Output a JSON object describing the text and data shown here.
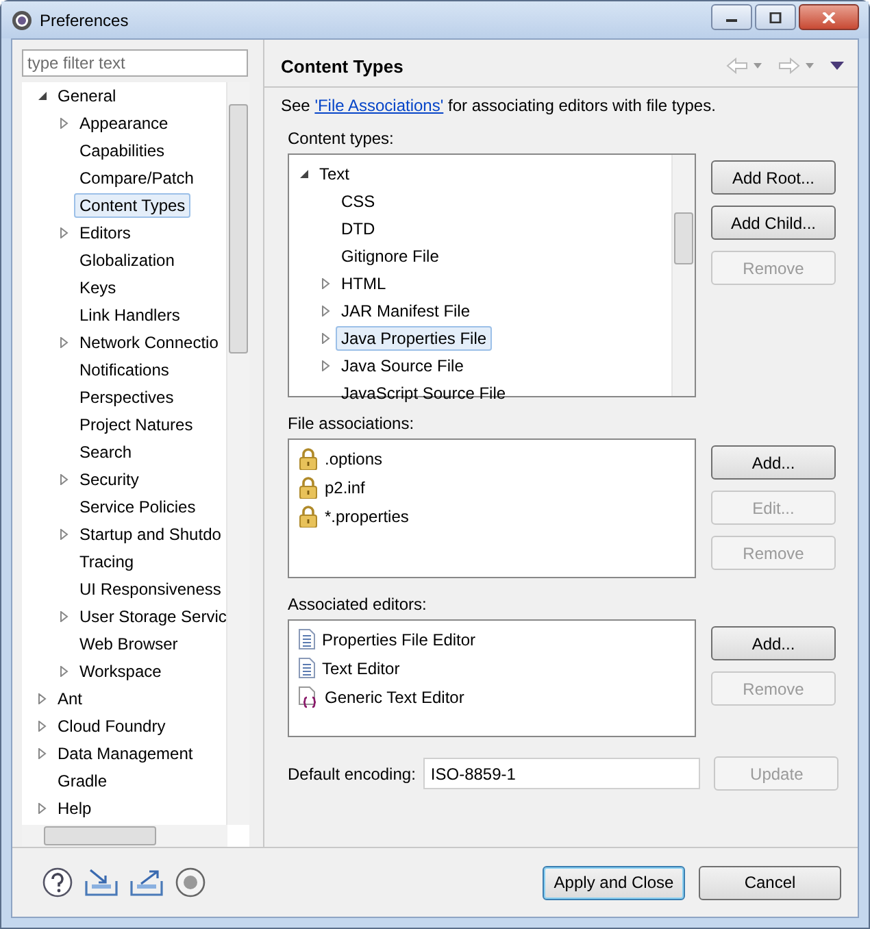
{
  "window": {
    "title": "Preferences"
  },
  "filter": {
    "placeholder": "type filter text"
  },
  "nav_tree": [
    {
      "label": "General",
      "expandable": true,
      "expanded": true,
      "selected": false,
      "children": [
        {
          "label": "Appearance",
          "expandable": true,
          "expanded": false,
          "selected": false
        },
        {
          "label": "Capabilities",
          "expandable": false,
          "selected": false
        },
        {
          "label": "Compare/Patch",
          "expandable": false,
          "selected": false
        },
        {
          "label": "Content Types",
          "expandable": false,
          "selected": true
        },
        {
          "label": "Editors",
          "expandable": true,
          "expanded": false,
          "selected": false
        },
        {
          "label": "Globalization",
          "expandable": false,
          "selected": false
        },
        {
          "label": "Keys",
          "expandable": false,
          "selected": false
        },
        {
          "label": "Link Handlers",
          "expandable": false,
          "selected": false
        },
        {
          "label": "Network Connectio",
          "expandable": true,
          "expanded": false,
          "selected": false
        },
        {
          "label": "Notifications",
          "expandable": false,
          "selected": false
        },
        {
          "label": "Perspectives",
          "expandable": false,
          "selected": false
        },
        {
          "label": "Project Natures",
          "expandable": false,
          "selected": false
        },
        {
          "label": "Search",
          "expandable": false,
          "selected": false
        },
        {
          "label": "Security",
          "expandable": true,
          "expanded": false,
          "selected": false
        },
        {
          "label": "Service Policies",
          "expandable": false,
          "selected": false
        },
        {
          "label": "Startup and Shutdo",
          "expandable": true,
          "expanded": false,
          "selected": false
        },
        {
          "label": "Tracing",
          "expandable": false,
          "selected": false
        },
        {
          "label": "UI Responsiveness",
          "expandable": false,
          "selected": false
        },
        {
          "label": "User Storage Servic",
          "expandable": true,
          "expanded": false,
          "selected": false
        },
        {
          "label": "Web Browser",
          "expandable": false,
          "selected": false
        },
        {
          "label": "Workspace",
          "expandable": true,
          "expanded": false,
          "selected": false
        }
      ]
    },
    {
      "label": "Ant",
      "expandable": true,
      "expanded": false,
      "selected": false
    },
    {
      "label": "Cloud Foundry",
      "expandable": true,
      "expanded": false,
      "selected": false
    },
    {
      "label": "Data Management",
      "expandable": true,
      "expanded": false,
      "selected": false
    },
    {
      "label": "Gradle",
      "expandable": false,
      "selected": false
    },
    {
      "label": "Help",
      "expandable": true,
      "expanded": false,
      "selected": false
    }
  ],
  "page": {
    "title": "Content Types",
    "intro_before": "See ",
    "intro_link": "'File Associations'",
    "intro_after": " for associating editors with file types."
  },
  "content_types": {
    "label": "Content types:",
    "tree": [
      {
        "label": "Text",
        "expandable": true,
        "expanded": true,
        "selected": false,
        "children": [
          {
            "label": "CSS",
            "expandable": false,
            "selected": false
          },
          {
            "label": "DTD",
            "expandable": false,
            "selected": false
          },
          {
            "label": "Gitignore File",
            "expandable": false,
            "selected": false
          },
          {
            "label": "HTML",
            "expandable": true,
            "expanded": false,
            "selected": false
          },
          {
            "label": "JAR Manifest File",
            "expandable": true,
            "expanded": false,
            "selected": false
          },
          {
            "label": "Java Properties File",
            "expandable": true,
            "expanded": false,
            "selected": true
          },
          {
            "label": "Java Source File",
            "expandable": true,
            "expanded": false,
            "selected": false
          },
          {
            "label": "JavaScript Source File",
            "expandable": false,
            "selected": false
          }
        ]
      }
    ],
    "buttons": [
      {
        "label": "Add Root...",
        "disabled": false
      },
      {
        "label": "Add Child...",
        "disabled": false
      },
      {
        "label": "Remove",
        "disabled": true
      }
    ]
  },
  "file_associations": {
    "label": "File associations:",
    "items": [
      ".options",
      "p2.inf",
      "*.properties"
    ],
    "buttons": [
      {
        "label": "Add...",
        "disabled": false
      },
      {
        "label": "Edit...",
        "disabled": true
      },
      {
        "label": "Remove",
        "disabled": true
      }
    ]
  },
  "associated_editors": {
    "label": "Associated editors:",
    "items": [
      {
        "label": "Properties File Editor",
        "kind": "document"
      },
      {
        "label": "Text Editor",
        "kind": "document"
      },
      {
        "label": "Generic Text Editor",
        "kind": "generic"
      }
    ],
    "buttons": [
      {
        "label": "Add...",
        "disabled": false
      },
      {
        "label": "Remove",
        "disabled": true
      }
    ]
  },
  "encoding": {
    "label": "Default encoding:",
    "value": "ISO-8859-1",
    "button": {
      "label": "Update",
      "disabled": true
    }
  },
  "footer_buttons": [
    {
      "label": "Apply and Close",
      "default": true
    },
    {
      "label": "Cancel",
      "default": false
    }
  ]
}
